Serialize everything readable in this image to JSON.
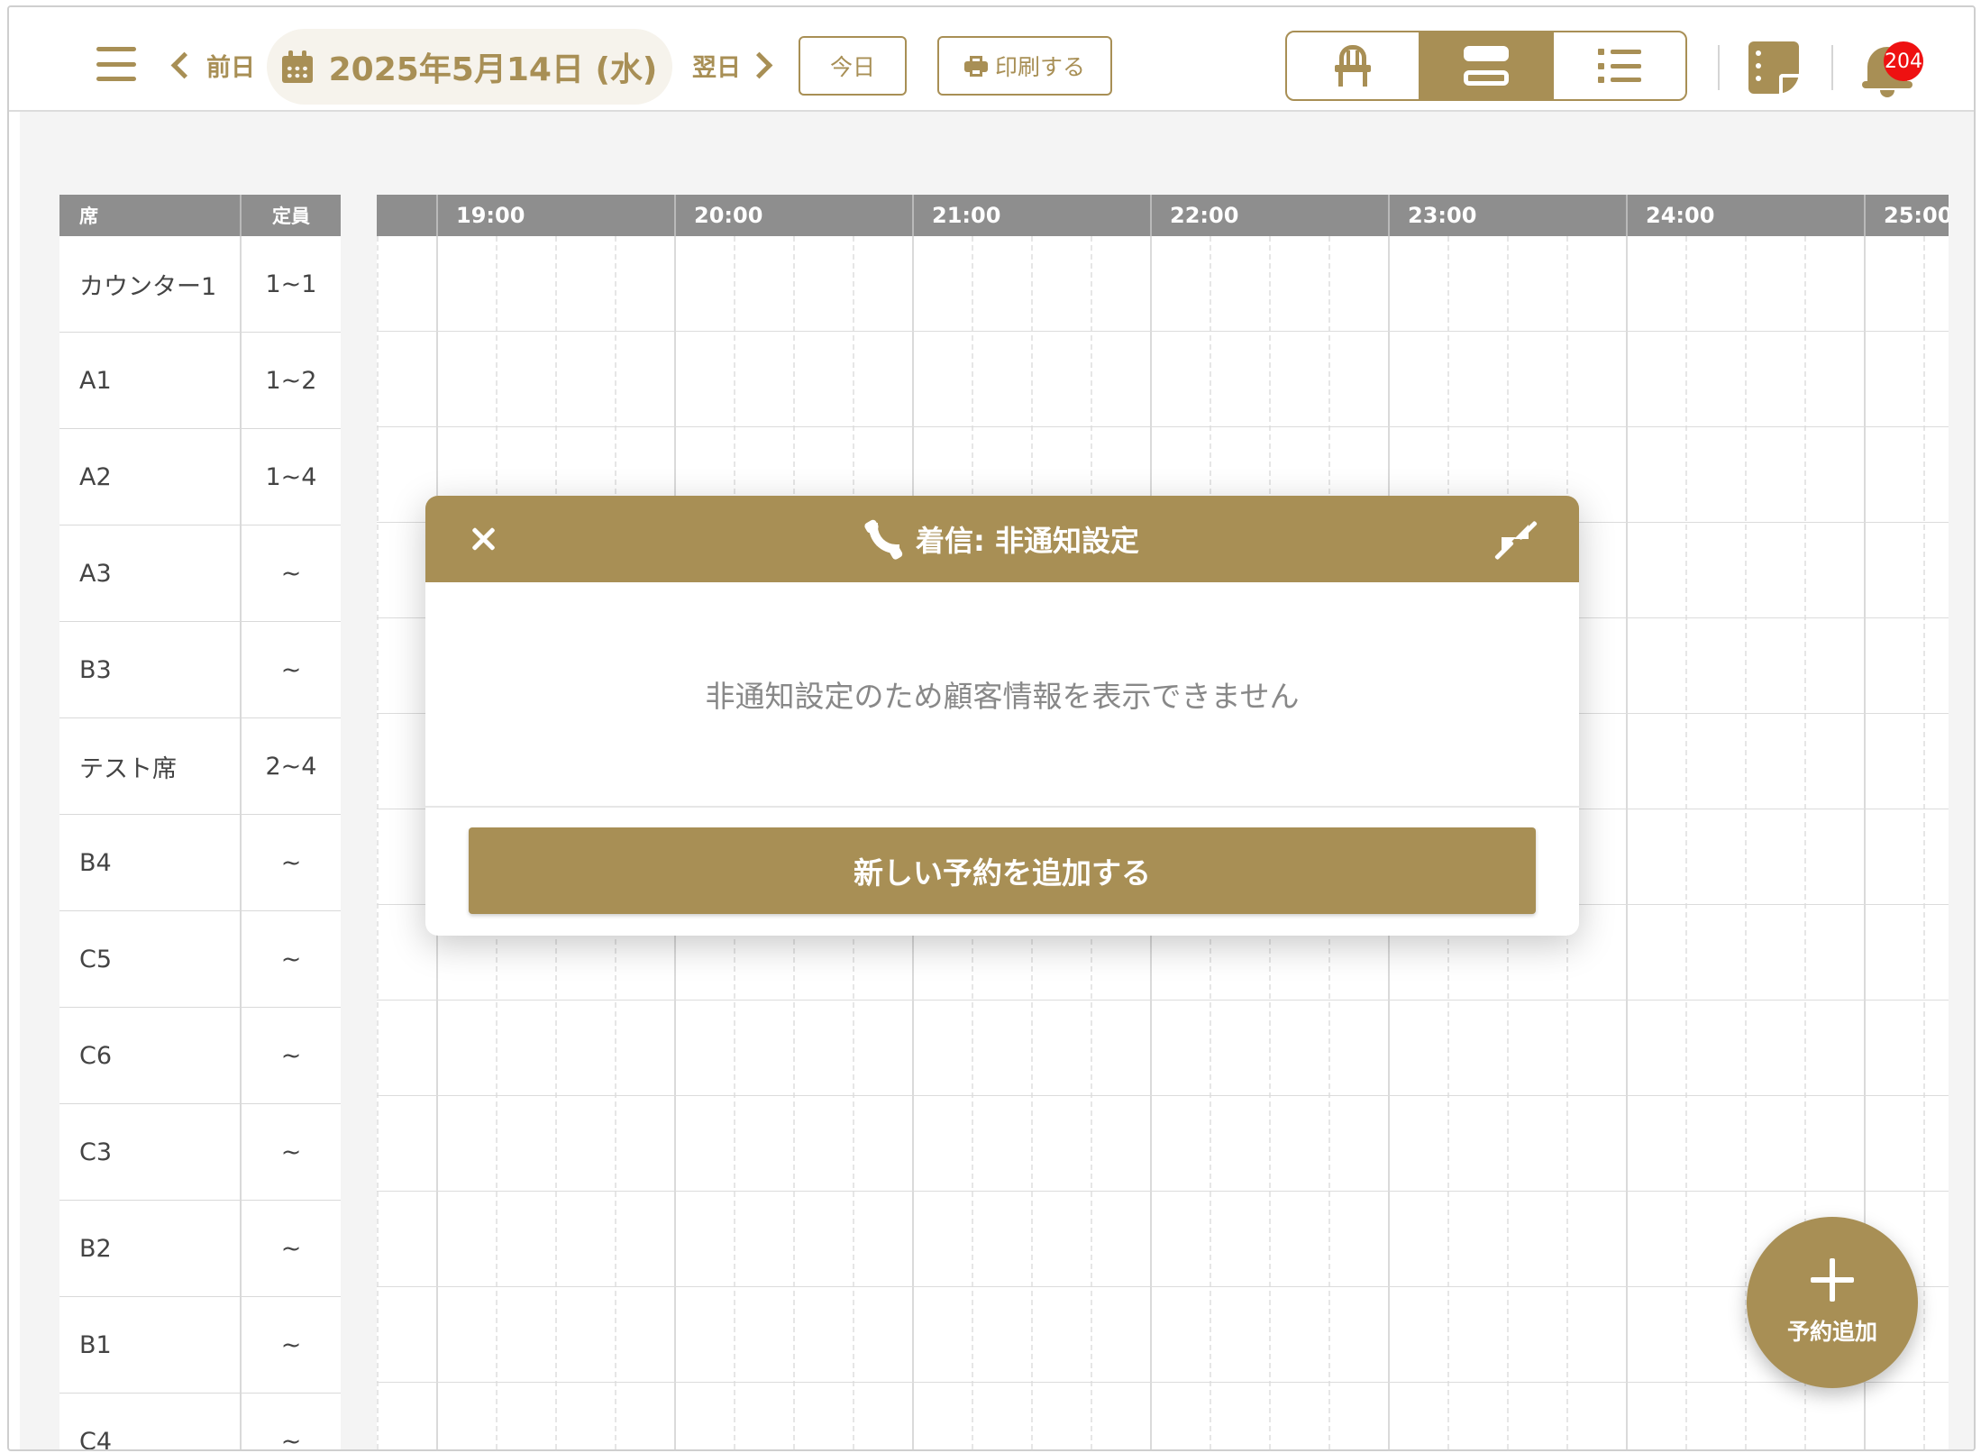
{
  "toolbar": {
    "prev_label": "前日",
    "next_label": "翌日",
    "date": "2025年5月14日 (水)",
    "today_label": "今日",
    "print_label": "印刷する",
    "notification_count": "204"
  },
  "seat_table": {
    "header_seat": "席",
    "header_capacity": "定員",
    "rows": [
      {
        "name": "カウンター1",
        "capacity": "1~1"
      },
      {
        "name": "A1",
        "capacity": "1~2"
      },
      {
        "name": "A2",
        "capacity": "1~4"
      },
      {
        "name": "A3",
        "capacity": "~"
      },
      {
        "name": "B3",
        "capacity": "~"
      },
      {
        "name": "テスト席",
        "capacity": "2~4"
      },
      {
        "name": "B4",
        "capacity": "~"
      },
      {
        "name": "C5",
        "capacity": "~"
      },
      {
        "name": "C6",
        "capacity": "~"
      },
      {
        "name": "C3",
        "capacity": "~"
      },
      {
        "name": "B2",
        "capacity": "~"
      },
      {
        "name": "B1",
        "capacity": "~"
      },
      {
        "name": "C4",
        "capacity": "~"
      }
    ]
  },
  "timeline": {
    "hours": [
      "19:00",
      "20:00",
      "21:00",
      "22:00",
      "23:00",
      "24:00",
      "25:00"
    ]
  },
  "modal": {
    "title": "着信: 非通知設定",
    "message": "非通知設定のため顧客情報を表示できません",
    "button_label": "新しい予約を追加する"
  },
  "fab": {
    "label": "予約追加"
  },
  "colors": {
    "accent": "#a88f55",
    "header_gray": "#8e8e8e",
    "badge_red": "#ee1111"
  }
}
